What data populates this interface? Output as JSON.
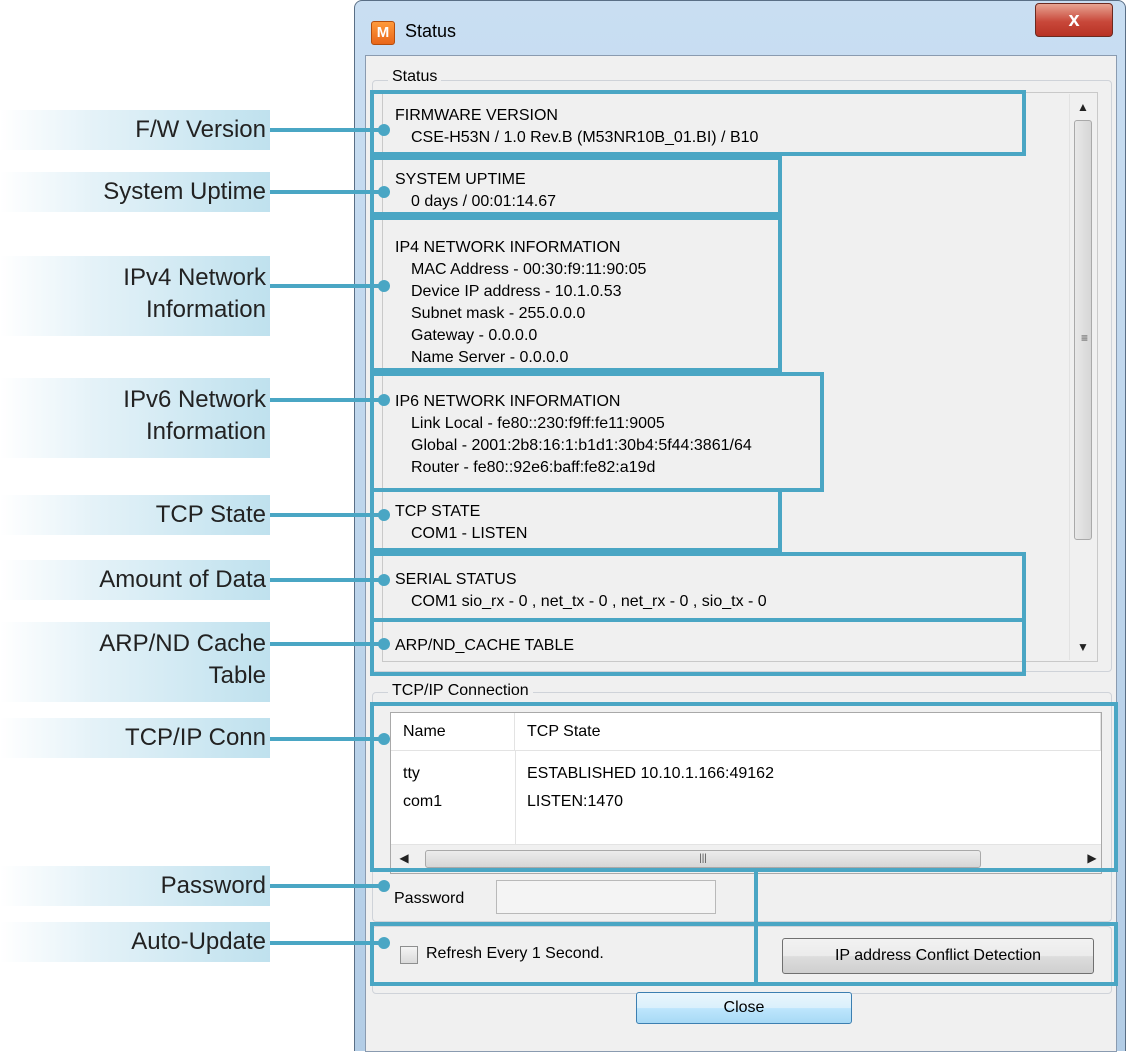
{
  "window": {
    "title": "Status",
    "app_icon_letter": "M",
    "close_glyph": "x"
  },
  "callouts": {
    "fw_version": "F/W Version",
    "system_uptime": "System Uptime",
    "ipv4_info": "IPv4 Network\nInformation",
    "ipv6_info": "IPv6 Network\nInformation",
    "tcp_state": "TCP State",
    "amount_of_data": "Amount of Data",
    "arp_nd_cache": "ARP/ND Cache\nTable",
    "tcpip_conn": "TCP/IP Conn",
    "password": "Password",
    "auto_update": "Auto-Update"
  },
  "status_group": {
    "label": "Status",
    "firmware_heading": "FIRMWARE VERSION",
    "firmware_value": "CSE-H53N / 1.0 Rev.B (M53NR10B_01.BI) / B10",
    "uptime_heading": "SYSTEM UPTIME",
    "uptime_value": "0 days / 00:01:14.67",
    "ip4_heading": "IP4 NETWORK INFORMATION",
    "ip4_mac": "MAC Address - 00:30:f9:11:90:05",
    "ip4_device_ip": "Device IP address - 10.1.0.53",
    "ip4_subnet": "Subnet mask - 255.0.0.0",
    "ip4_gateway": "Gateway - 0.0.0.0",
    "ip4_name_server": "Name Server - 0.0.0.0",
    "ip6_heading": "IP6 NETWORK INFORMATION",
    "ip6_link_local": "Link Local - fe80::230:f9ff:fe11:9005",
    "ip6_global": "Global - 2001:2b8:16:1:b1d1:30b4:5f44:3861/64",
    "ip6_router": "Router - fe80::92e6:baff:fe82:a19d",
    "tcp_heading": "TCP STATE",
    "tcp_com1": "COM1 - LISTEN",
    "serial_heading": "SERIAL STATUS",
    "serial_com1": "COM1  sio_rx - 0 , net_tx - 0 , net_rx - 0 , sio_tx - 0",
    "arp_heading": "ARP/ND_CACHE TABLE"
  },
  "tcpip_group": {
    "label": "TCP/IP Connection",
    "columns": [
      "Name",
      "TCP State"
    ],
    "rows": [
      [
        "tty",
        "ESTABLISHED 10.10.1.166:49162"
      ],
      [
        "com1",
        "LISTEN:1470"
      ]
    ]
  },
  "password": {
    "label": "Password",
    "value": ""
  },
  "refresh_checkbox": {
    "label": "Refresh Every 1 Second.",
    "checked": false
  },
  "buttons": {
    "ip_conflict": "IP address Conflict Detection",
    "close": "Close"
  },
  "colors": {
    "callout_accent": "#4aa6c4"
  }
}
